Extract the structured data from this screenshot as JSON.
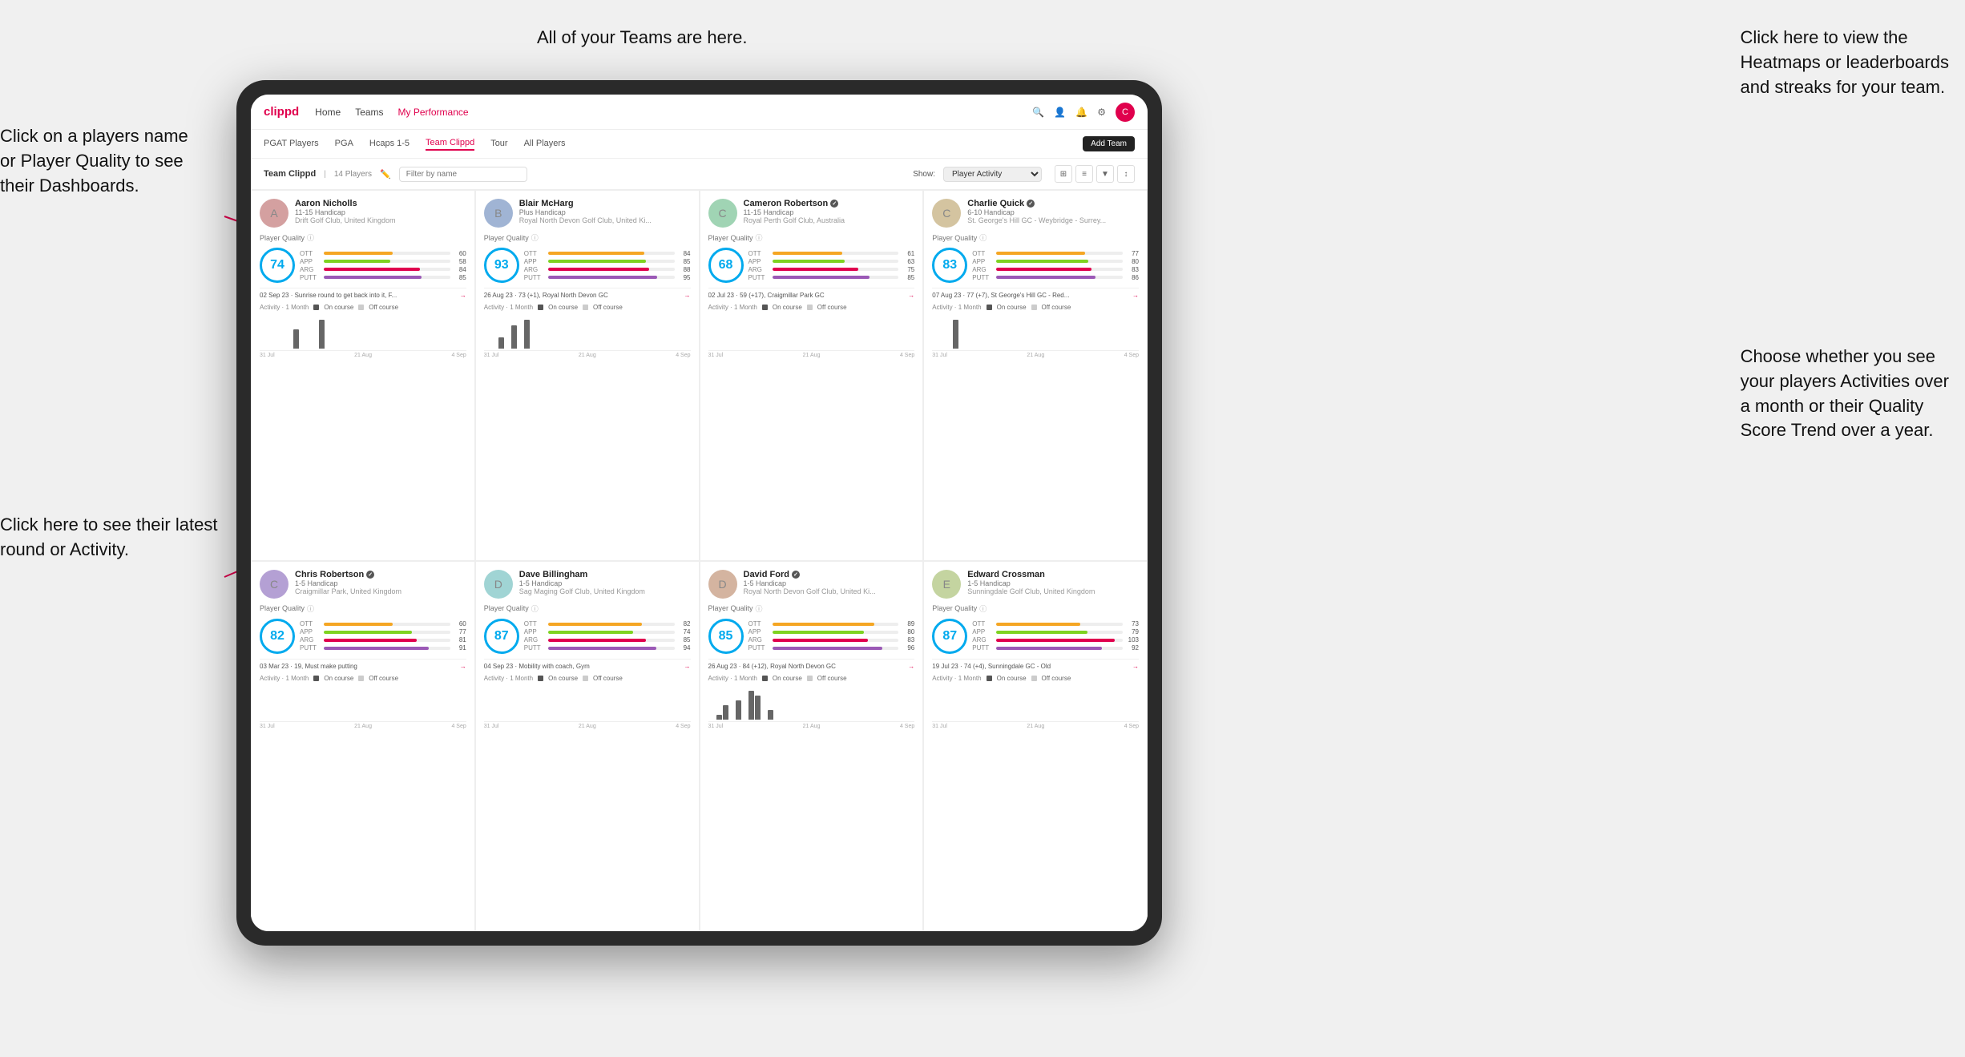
{
  "annotations": {
    "click_player": "Click on a players name\nor Player Quality to see\ntheir Dashboards.",
    "teams_here": "All of your Teams are here.",
    "heatmaps": "Click here to view the\nHeatmaps or leaderboards\nand streaks for your team.",
    "latest_round": "Click here to see their latest\nround or Activity.",
    "activities": "Choose whether you see\nyour players Activities over\na month or their Quality\nScore Trend over a year."
  },
  "nav": {
    "brand": "clippd",
    "items": [
      "Home",
      "Teams",
      "My Performance"
    ],
    "active": "My Performance"
  },
  "sub_nav": {
    "items": [
      "PGAT Players",
      "PGA",
      "Hcaps 1-5",
      "Team Clippd",
      "Tour",
      "All Players"
    ],
    "active": "Team Clippd",
    "add_team": "Add Team"
  },
  "team_header": {
    "title": "Team Clippd",
    "separator": "|",
    "count": "14 Players",
    "filter_placeholder": "Filter by name",
    "show_label": "Show:",
    "show_value": "Player Activity",
    "view_options": [
      "grid",
      "list",
      "filter",
      "sort"
    ]
  },
  "players": [
    {
      "name": "Aaron Nicholls",
      "handicap": "11-15 Handicap",
      "club": "Drift Golf Club, United Kingdom",
      "quality": 74,
      "color": "#00aaee",
      "stats": {
        "OTT": {
          "val": 60,
          "color": "#f5a623"
        },
        "APP": {
          "val": 58,
          "color": "#7ed321"
        },
        "ARG": {
          "val": 84,
          "color": "#e0004d"
        },
        "PUTT": {
          "val": 85,
          "color": "#9b59b6"
        }
      },
      "last_round": "02 Sep 23 · Sunrise round to get back into it, F...",
      "activity_label": "Activity · 1 Month",
      "bars": [
        0,
        0,
        0,
        0,
        0,
        2,
        0,
        0,
        0,
        3,
        0
      ],
      "dates": [
        "31 Jul",
        "21 Aug",
        "4 Sep"
      ]
    },
    {
      "name": "Blair McHarg",
      "handicap": "Plus Handicap",
      "club": "Royal North Devon Golf Club, United Ki...",
      "quality": 93,
      "color": "#00aaee",
      "stats": {
        "OTT": {
          "val": 84,
          "color": "#f5a623"
        },
        "APP": {
          "val": 85,
          "color": "#7ed321"
        },
        "ARG": {
          "val": 88,
          "color": "#e0004d"
        },
        "PUTT": {
          "val": 95,
          "color": "#9b59b6"
        }
      },
      "last_round": "26 Aug 23 · 73 (+1), Royal North Devon GC",
      "activity_label": "Activity · 1 Month",
      "bars": [
        0,
        0,
        2,
        0,
        4,
        0,
        5,
        0,
        0,
        0,
        0
      ],
      "dates": [
        "31 Jul",
        "21 Aug",
        "4 Sep"
      ]
    },
    {
      "name": "Cameron Robertson",
      "handicap": "11-15 Handicap",
      "club": "Royal Perth Golf Club, Australia",
      "quality": 68,
      "color": "#00aaee",
      "stats": {
        "OTT": {
          "val": 61,
          "color": "#f5a623"
        },
        "APP": {
          "val": 63,
          "color": "#7ed321"
        },
        "ARG": {
          "val": 75,
          "color": "#e0004d"
        },
        "PUTT": {
          "val": 85,
          "color": "#9b59b6"
        }
      },
      "last_round": "02 Jul 23 · 59 (+17), Craigmillar Park GC",
      "activity_label": "Activity · 1 Month",
      "bars": [
        0,
        0,
        0,
        0,
        0,
        0,
        0,
        0,
        0,
        0,
        0
      ],
      "dates": [
        "31 Jul",
        "21 Aug",
        "4 Sep"
      ]
    },
    {
      "name": "Charlie Quick",
      "handicap": "6-10 Handicap",
      "club": "St. George's Hill GC - Weybridge - Surrey...",
      "quality": 83,
      "color": "#00aaee",
      "stats": {
        "OTT": {
          "val": 77,
          "color": "#f5a623"
        },
        "APP": {
          "val": 80,
          "color": "#7ed321"
        },
        "ARG": {
          "val": 83,
          "color": "#e0004d"
        },
        "PUTT": {
          "val": 86,
          "color": "#9b59b6"
        }
      },
      "last_round": "07 Aug 23 · 77 (+7), St George's Hill GC - Red...",
      "activity_label": "Activity · 1 Month",
      "bars": [
        0,
        0,
        0,
        2,
        0,
        0,
        0,
        0,
        0,
        0,
        0
      ],
      "dates": [
        "31 Jul",
        "21 Aug",
        "4 Sep"
      ]
    },
    {
      "name": "Chris Robertson",
      "handicap": "1-5 Handicap",
      "club": "Craigmillar Park, United Kingdom",
      "quality": 82,
      "color": "#00aaee",
      "stats": {
        "OTT": {
          "val": 60,
          "color": "#f5a623"
        },
        "APP": {
          "val": 77,
          "color": "#7ed321"
        },
        "ARG": {
          "val": 81,
          "color": "#e0004d"
        },
        "PUTT": {
          "val": 91,
          "color": "#9b59b6"
        }
      },
      "last_round": "03 Mar 23 · 19, Must make putting",
      "activity_label": "Activity · 1 Month",
      "bars": [
        0,
        0,
        0,
        0,
        0,
        0,
        0,
        0,
        0,
        0,
        0
      ],
      "dates": [
        "31 Jul",
        "21 Aug",
        "4 Sep"
      ]
    },
    {
      "name": "Dave Billingham",
      "handicap": "1-5 Handicap",
      "club": "Sag Maging Golf Club, United Kingdom",
      "quality": 87,
      "color": "#00aaee",
      "stats": {
        "OTT": {
          "val": 82,
          "color": "#f5a623"
        },
        "APP": {
          "val": 74,
          "color": "#7ed321"
        },
        "ARG": {
          "val": 85,
          "color": "#e0004d"
        },
        "PUTT": {
          "val": 94,
          "color": "#9b59b6"
        }
      },
      "last_round": "04 Sep 23 · Mobility with coach, Gym",
      "activity_label": "Activity · 1 Month",
      "bars": [
        0,
        0,
        0,
        0,
        0,
        0,
        0,
        0,
        0,
        0,
        0
      ],
      "dates": [
        "31 Jul",
        "21 Aug",
        "4 Sep"
      ]
    },
    {
      "name": "David Ford",
      "handicap": "1-5 Handicap",
      "club": "Royal North Devon Golf Club, United Ki...",
      "quality": 85,
      "color": "#00aaee",
      "stats": {
        "OTT": {
          "val": 89,
          "color": "#f5a623"
        },
        "APP": {
          "val": 80,
          "color": "#7ed321"
        },
        "ARG": {
          "val": 83,
          "color": "#e0004d"
        },
        "PUTT": {
          "val": 96,
          "color": "#9b59b6"
        }
      },
      "last_round": "26 Aug 23 · 84 (+12), Royal North Devon GC",
      "activity_label": "Activity · 1 Month",
      "bars": [
        0,
        1,
        3,
        0,
        4,
        0,
        6,
        5,
        0,
        2,
        0
      ],
      "dates": [
        "31 Jul",
        "21 Aug",
        "4 Sep"
      ]
    },
    {
      "name": "Edward Crossman",
      "handicap": "1-5 Handicap",
      "club": "Sunningdale Golf Club, United Kingdom",
      "quality": 87,
      "color": "#00aaee",
      "stats": {
        "OTT": {
          "val": 73,
          "color": "#f5a623"
        },
        "APP": {
          "val": 79,
          "color": "#7ed321"
        },
        "ARG": {
          "val": 103,
          "color": "#e0004d"
        },
        "PUTT": {
          "val": 92,
          "color": "#9b59b6"
        }
      },
      "last_round": "19 Jul 23 · 74 (+4), Sunningdale GC - Old",
      "activity_label": "Activity · 1 Month",
      "bars": [
        0,
        0,
        0,
        0,
        0,
        0,
        0,
        0,
        0,
        0,
        0
      ],
      "dates": [
        "31 Jul",
        "21 Aug",
        "4 Sep"
      ]
    }
  ],
  "legend": {
    "on_course": "On course",
    "off_course": "Off course",
    "on_color": "#555",
    "off_color": "#ccc"
  }
}
